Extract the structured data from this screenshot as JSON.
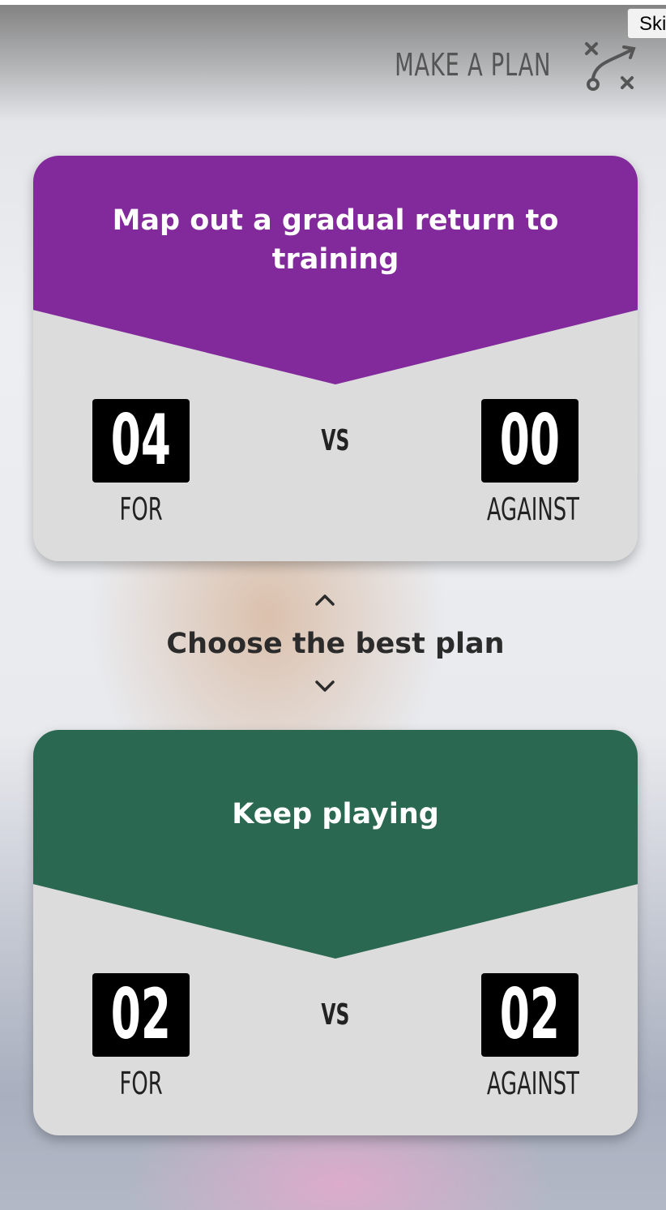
{
  "header": {
    "brand_label": "MAKE A PLAN",
    "brand_icon": "play-diagram-icon",
    "skip_label": "Skip"
  },
  "colors": {
    "plan1_header": "#82299b",
    "plan2_header": "#2b6852",
    "card_body": "#dcdcdc",
    "score_box": "#000000"
  },
  "plans": [
    {
      "title": "Map out a gradual return to training",
      "for_value": "04",
      "for_label": "FOR",
      "vs_label": "VS",
      "against_value": "00",
      "against_label": "AGAINST"
    },
    {
      "title": "Keep playing",
      "for_value": "02",
      "for_label": "FOR",
      "vs_label": "VS",
      "against_value": "02",
      "against_label": "AGAINST"
    }
  ],
  "chooser": {
    "label": "Choose the best plan",
    "up_icon": "chevron-up-icon",
    "down_icon": "chevron-down-icon"
  }
}
